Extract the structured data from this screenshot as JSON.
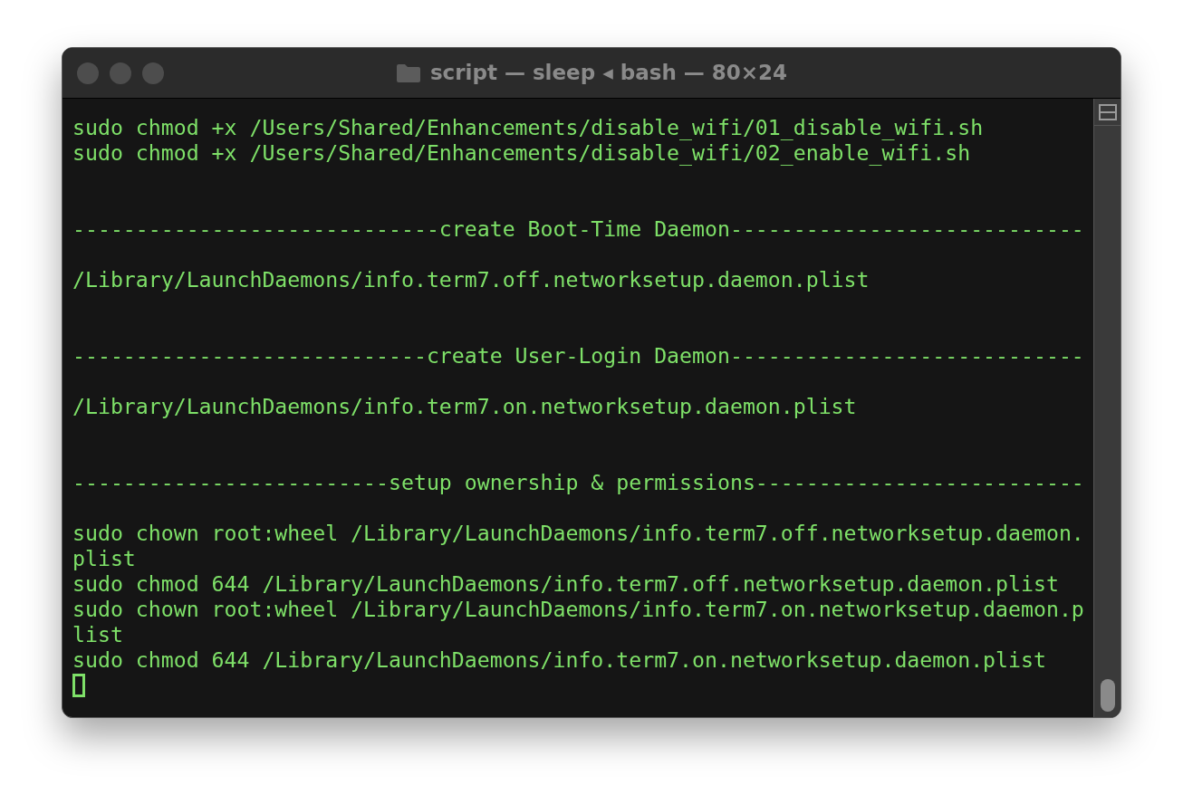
{
  "window": {
    "title": "script — sleep ◂ bash — 80×24",
    "focused": false
  },
  "terminal": {
    "lines": [
      {
        "kind": "output",
        "text": "sudo chmod +x /Users/Shared/Enhancements/disable_wifi/01_disable_wifi.sh"
      },
      {
        "kind": "output",
        "text": "sudo chmod +x /Users/Shared/Enhancements/disable_wifi/02_enable_wifi.sh"
      },
      {
        "kind": "heading",
        "text": "-----------------------------create Boot-Time Daemon----------------------------"
      },
      {
        "kind": "output",
        "text": "/Library/LaunchDaemons/info.term7.off.networksetup.daemon.plist"
      },
      {
        "kind": "heading",
        "text": "----------------------------create User-Login Daemon----------------------------"
      },
      {
        "kind": "output",
        "text": "/Library/LaunchDaemons/info.term7.on.networksetup.daemon.plist"
      },
      {
        "kind": "heading",
        "text": "-------------------------setup ownership & permissions--------------------------"
      },
      {
        "kind": "output",
        "text": "sudo chown root:wheel /Library/LaunchDaemons/info.term7.off.networksetup.daemon."
      },
      {
        "kind": "output",
        "text": "plist"
      },
      {
        "kind": "output",
        "text": "sudo chmod 644 /Library/LaunchDaemons/info.term7.off.networksetup.daemon.plist"
      },
      {
        "kind": "output",
        "text": "sudo chown root:wheel /Library/LaunchDaemons/info.term7.on.networksetup.daemon.p"
      },
      {
        "kind": "output",
        "text": "list"
      },
      {
        "kind": "output",
        "text": "sudo chmod 644 /Library/LaunchDaemons/info.term7.on.networksetup.daemon.plist"
      }
    ],
    "cursor": true
  }
}
